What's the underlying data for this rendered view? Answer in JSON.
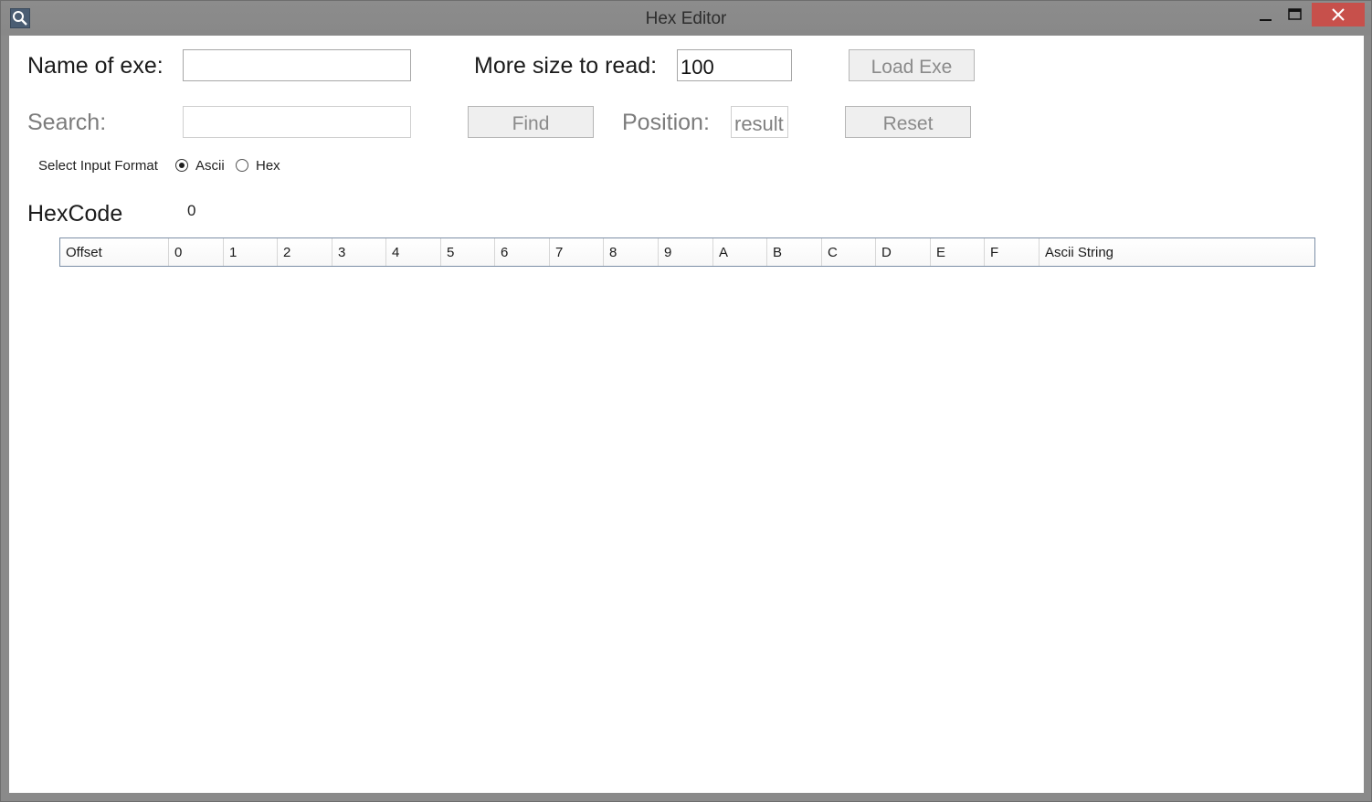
{
  "window": {
    "title": "Hex Editor",
    "colors": {
      "titlebar": "#8c8c8c",
      "close_button": "#c7504b",
      "grid_border": "#7c8fa6"
    }
  },
  "form": {
    "name_label": "Name of exe:",
    "name_value": "",
    "size_label": "More size to read:",
    "size_value": "100",
    "load_button": "Load Exe",
    "search_label": "Search:",
    "search_value": "",
    "find_button": "Find",
    "position_label": "Position:",
    "position_value": "result",
    "reset_button": "Reset",
    "format_label": "Select Input Format",
    "format_options": [
      {
        "label": "Ascii",
        "selected": true
      },
      {
        "label": "Hex",
        "selected": false
      }
    ]
  },
  "hexcode": {
    "label": "HexCode",
    "value": "0"
  },
  "grid": {
    "columns": [
      "Offset",
      "0",
      "1",
      "2",
      "3",
      "4",
      "5",
      "6",
      "7",
      "8",
      "9",
      "A",
      "B",
      "C",
      "D",
      "E",
      "F",
      "Ascii String"
    ],
    "rows": []
  }
}
